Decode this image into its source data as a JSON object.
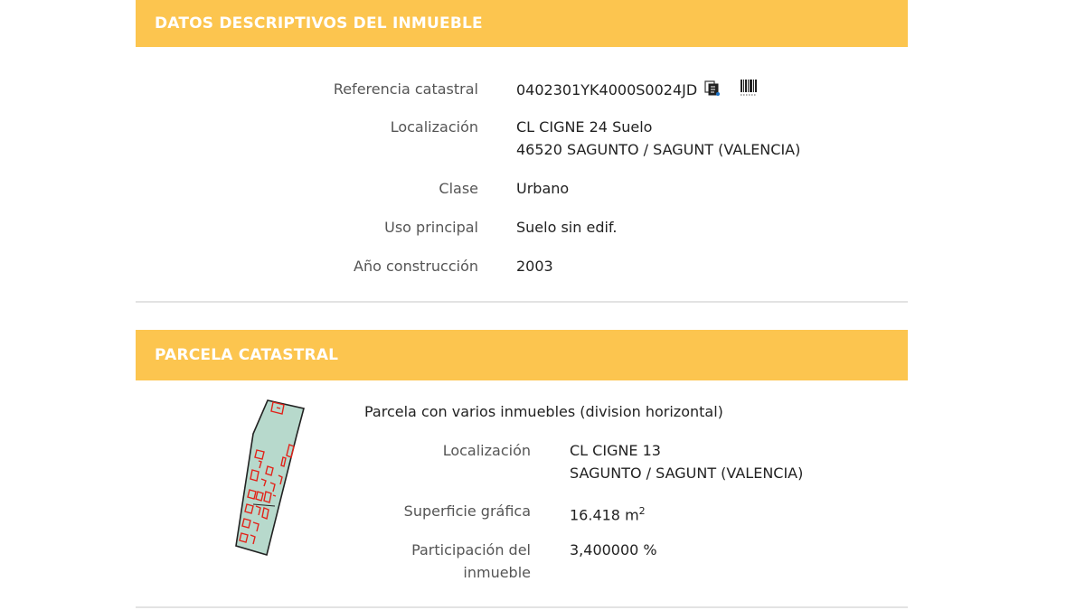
{
  "section1": {
    "title": "DATOS DESCRIPTIVOS DEL INMUEBLE",
    "rows": {
      "referencia": {
        "label": "Referencia catastral",
        "value": "0402301YK4000S0024JD"
      },
      "localizacion": {
        "label": "Localización",
        "line1": "CL CIGNE 24 Suelo",
        "line2": "46520 SAGUNTO / SAGUNT (VALENCIA)"
      },
      "clase": {
        "label": "Clase",
        "value": "Urbano"
      },
      "uso": {
        "label": "Uso principal",
        "value": "Suelo sin edif."
      },
      "anio": {
        "label": "Año construcción",
        "value": "2003"
      }
    },
    "icons": [
      "copy-icon",
      "barcode-icon"
    ]
  },
  "section2": {
    "title": "PARCELA CATASTRAL",
    "description": "Parcela con varios inmuebles (division horizontal)",
    "rows": {
      "localizacion": {
        "label": "Localización",
        "line1": "CL CIGNE 13",
        "line2": "SAGUNTO / SAGUNT (VALENCIA)"
      },
      "superficie": {
        "label": "Superficie gráfica",
        "value": "16.418 m",
        "unit_exp": "2"
      },
      "participacion": {
        "label_line1": "Participación del",
        "label_line2": "inmueble",
        "value": "3,400000 %"
      }
    }
  },
  "colors": {
    "header_bg": "#fcc54f",
    "header_text": "#ffffff",
    "parcel_fill": "#b7d9cc",
    "parcel_lines": "#e2231a"
  }
}
